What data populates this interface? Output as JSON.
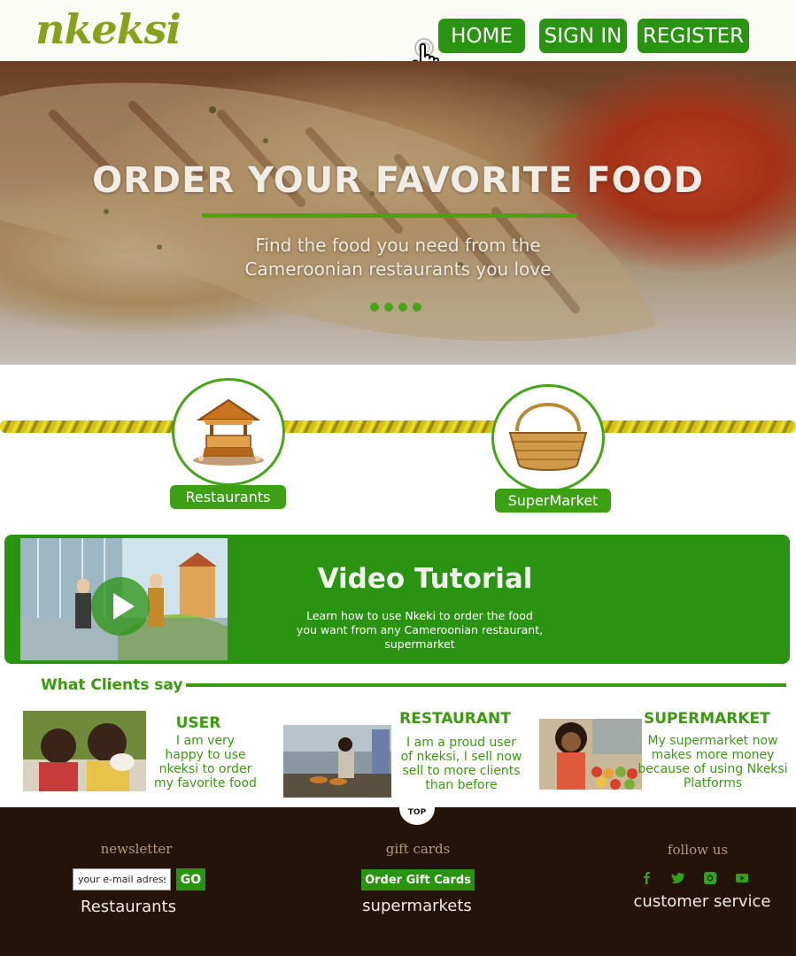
{
  "header": {
    "logo_text": "nkeksi",
    "nav": [
      {
        "label": "HOME"
      },
      {
        "label": "SIGN IN"
      },
      {
        "label": "REGISTER"
      }
    ]
  },
  "hero": {
    "title": "ORDER YOUR FAVORITE FOOD",
    "subtitle_line1": "Find the food you need from the",
    "subtitle_line2": "Cameroonian restaurants you love",
    "slide_count": 4
  },
  "categories": [
    {
      "label": "Restaurants",
      "icon": "restaurant-hut-icon"
    },
    {
      "label": "SuperMarket",
      "icon": "basket-icon"
    }
  ],
  "video": {
    "title": "Video Tutorial",
    "description_line1": "Learn how to use Nkeki to order the food",
    "description_line2": "you want from any Cameroonian restaurant,",
    "description_line3": "supermarket"
  },
  "clients": {
    "heading": "What Clients say",
    "items": [
      {
        "title": "USER",
        "lines": [
          "I am very",
          "happy to use",
          "nkeksi to order",
          "my favorite food"
        ]
      },
      {
        "title": "RESTAURANT",
        "lines": [
          "I am a proud user",
          "of nkeksi, I sell now",
          "sell to more clients",
          "than before"
        ]
      },
      {
        "title": "SUPERMARKET",
        "lines": [
          "My supermarket now",
          "makes more money",
          "because of using Nkeksi",
          "Platforms"
        ]
      }
    ]
  },
  "footer": {
    "top_label": "TOP",
    "newsletter": {
      "heading": "newsletter",
      "placeholder": "your e-mail adress",
      "go_label": "GO",
      "link": "Restaurants"
    },
    "gift_cards": {
      "heading": "gift cards",
      "button_label": "Order Gift Cards",
      "link": "supermarkets"
    },
    "follow": {
      "heading": "follow us",
      "icons": [
        "facebook-icon",
        "twitter-icon",
        "instagram-icon",
        "youtube-icon"
      ],
      "link": "customer service"
    }
  },
  "colors": {
    "brand_green": "#2a9312",
    "footer_bg": "#231308",
    "accent_yellow": "#f1e62a"
  }
}
